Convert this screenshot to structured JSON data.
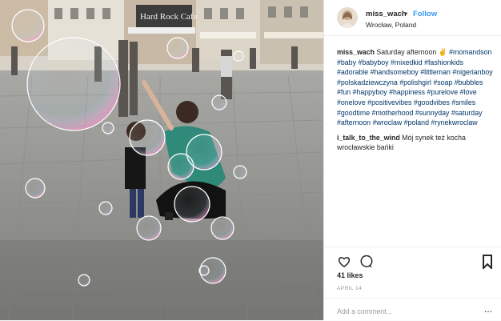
{
  "post": {
    "image_alt": "Boy and woman playing with soap bubbles on a cobblestone square",
    "storefront_sign": "Hard Rock Cafe"
  },
  "header": {
    "username": "miss_wach",
    "separator": "•",
    "follow_label": "Follow",
    "location": "Wrocław, Poland"
  },
  "caption": {
    "username": "miss_wach",
    "text": "Saturday afternoon ✌️",
    "hashtags": [
      "#momandson",
      "#baby",
      "#babyboy",
      "#mixedkid",
      "#fashionkids",
      "#adorable",
      "#handsomeboy",
      "#littleman",
      "#nigerianboy",
      "#polskadziewczyna",
      "#polishgirl",
      "#soap",
      "#bubbles",
      "#fun",
      "#happyboy",
      "#happiness",
      "#purelove",
      "#love",
      "#onelove",
      "#positivevibes",
      "#goodvibes",
      "#smiles",
      "#goodtime",
      "#motherhood",
      "#sunnyday",
      "#saturday",
      "#afternoon",
      "#wroclaw",
      "#poland",
      "#rynekwroclaw"
    ]
  },
  "comments": [
    {
      "username": "i_talk_to_the_wind",
      "text": "Mój synek też kocha wrocławskie bańki"
    }
  ],
  "stats": {
    "likes": "41 likes",
    "date": "APRIL 14"
  },
  "add_comment": {
    "placeholder": "Add a comment...",
    "more": "..."
  },
  "colors": {
    "link_blue": "#3897f0",
    "hashtag": "#003569",
    "text": "#262626",
    "muted": "#999999"
  },
  "icons": [
    "heart-icon",
    "comment-icon",
    "bookmark-icon",
    "more-icon"
  ]
}
